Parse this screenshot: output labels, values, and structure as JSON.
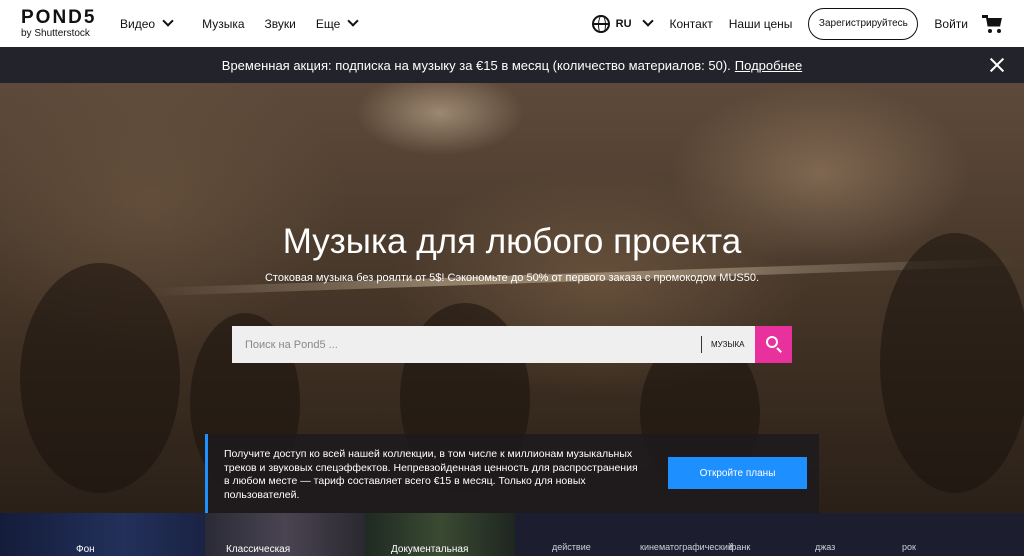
{
  "header": {
    "logo_main": "POND5",
    "logo_sub": "by Shutterstock",
    "nav": [
      "Видео",
      "Музыка",
      "Звуки",
      "Еще"
    ],
    "lang": "RU",
    "contact": "Контакт",
    "prices": "Наши цены",
    "signup": "Зарегистрируйтесь",
    "login": "Войти"
  },
  "promo": {
    "text": "Временная акция: подписка на музыку за €15 в месяц (количество материалов: 50).",
    "link": "Подробнее"
  },
  "hero": {
    "title": "Музыка для любого проекта",
    "subtitle": "Стоковая музыка без роялти от 5$! Сэкономьте до 50% от первого заказа с промокодом MUS50.",
    "search_placeholder": "Поиск на Pond5 ...",
    "search_category": "МУЗЫКА"
  },
  "access": {
    "text": "Получите доступ ко всей нашей коллекции, в том числе к миллионам музыкальных треков и звуковых спецэффектов. Непревзойденная ценность для распространения в любом месте — тариф составляет всего €15 в месяц. Только для новых пользователей.",
    "button": "Откройте планы"
  },
  "genres": {
    "tiles": [
      "Фон",
      "Классическая",
      "Документальная"
    ],
    "tags": [
      "действие",
      "кинематографический",
      "фанк",
      "джаз",
      "рок"
    ]
  },
  "colors": {
    "accent_pink": "#e8319d",
    "accent_blue": "#1e8fff",
    "promo_bg": "#23232b"
  }
}
